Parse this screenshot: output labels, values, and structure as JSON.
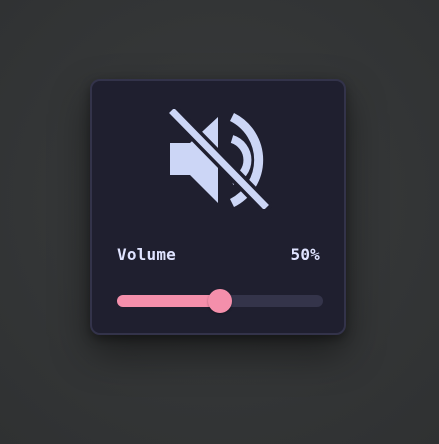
{
  "volume_control": {
    "label": "Volume",
    "value_text": "50%",
    "level": 0.5,
    "muted": true,
    "icon": "speaker-muted-icon"
  },
  "colors": {
    "card_background": "#1f1f2f",
    "accent": "#f48fab",
    "icon": "#ccd6f6",
    "track": "#34344a",
    "text": "#dfe3ff"
  }
}
